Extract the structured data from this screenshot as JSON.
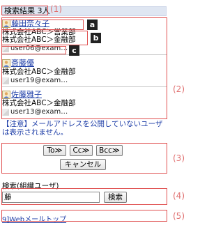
{
  "header": {
    "title": "検索結果 3人"
  },
  "contacts": [
    {
      "name": "藤田奈々子",
      "dept1": "株式会社ABC＞営業部",
      "dept2": "株式会社ABC＞金融部",
      "email": "user06@exam…"
    },
    {
      "name": "斎藤優",
      "dept1": "株式会社ABC＞金融部",
      "email": "user19@exam…"
    },
    {
      "name": "佐藤雅子",
      "dept1": "株式会社ABC＞金融部",
      "email": "user13@exam…"
    }
  ],
  "warning": {
    "mark": "【注意】",
    "text": "メールアドレスを公開していないユーザは表示されません。"
  },
  "buttons": {
    "to": "To≫",
    "cc": "Cc≫",
    "bcc": "Bcc≫",
    "cancel": "キャンセル"
  },
  "search": {
    "label": "検索(組織ユーザ)",
    "value": "藤",
    "button": "検索"
  },
  "footer": {
    "link": "9]Webメールトップ"
  },
  "annotations": {
    "letters": [
      "a",
      "b",
      "c"
    ],
    "numbers": [
      "(1)",
      "(2)",
      "(3)",
      "(4)",
      "(5)"
    ]
  },
  "colors": {
    "annotation": "#e05050",
    "link": "#1f3fa8",
    "header_bg": "#dfe6f2"
  }
}
